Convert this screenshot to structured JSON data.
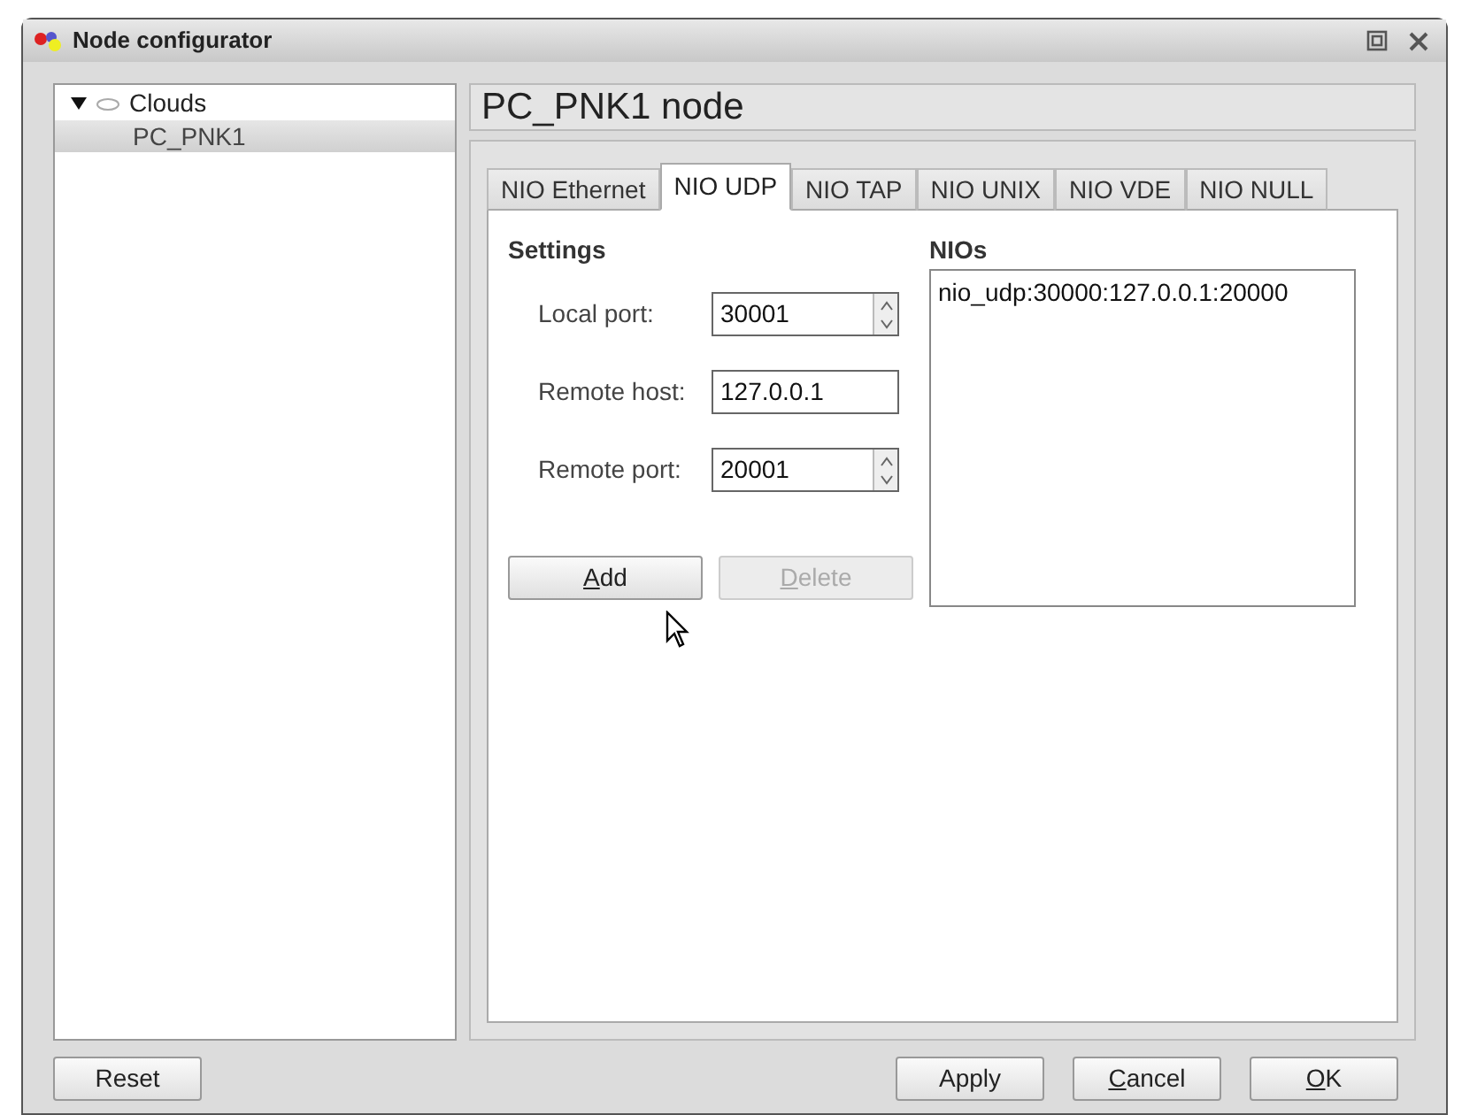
{
  "window": {
    "title": "Node configurator"
  },
  "tree": [
    {
      "label": "Clouds",
      "expanded": true,
      "selected": false,
      "children": [
        {
          "label": "PC_PNK1",
          "selected": true
        }
      ]
    }
  ],
  "header": "PC_PNK1 node",
  "tabs": [
    {
      "label": "NIO Ethernet",
      "selected": false
    },
    {
      "label": "NIO UDP",
      "selected": true
    },
    {
      "label": "NIO TAP",
      "selected": false
    },
    {
      "label": "NIO UNIX",
      "selected": false
    },
    {
      "label": "NIO VDE",
      "selected": false
    },
    {
      "label": "NIO NULL",
      "selected": false
    }
  ],
  "settings": {
    "title": "Settings",
    "fields": [
      {
        "kind": "spin",
        "label": "Local port:",
        "value": "30001"
      },
      {
        "kind": "text",
        "label": "Remote host:",
        "value": "127.0.0.1"
      },
      {
        "kind": "spin",
        "label": "Remote port:",
        "value": "20001"
      }
    ],
    "buttons": [
      {
        "label": "Add",
        "disabled": false,
        "mnemonic": true
      },
      {
        "label": "Delete",
        "disabled": true,
        "mnemonic": true
      }
    ]
  },
  "nios": {
    "title": "NIOs",
    "items": [
      "nio_udp:30000:127.0.0.1:20000"
    ]
  },
  "footer": {
    "left": [
      {
        "label": "Reset",
        "mnemonic": false
      }
    ],
    "right": [
      {
        "label": "Apply",
        "mnemonic": false
      },
      {
        "label": "Cancel",
        "mnemonic": true
      },
      {
        "label": "OK",
        "mnemonic": true
      }
    ]
  }
}
